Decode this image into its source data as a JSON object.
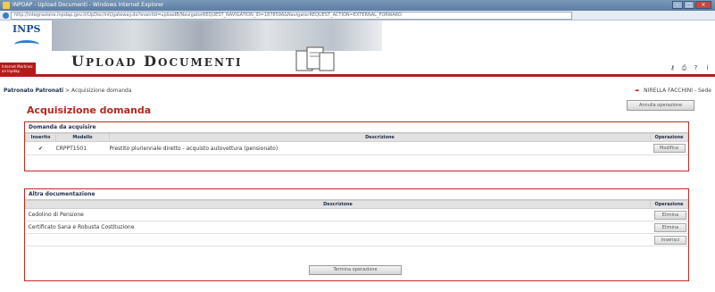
{
  "window": {
    "title": "INPOAP - Upload Documenti - Windows Internet Explorer",
    "url": "http://integrazione.inpdap.gov.it/UpDoc/init/gateway.do?eventId=uploadB/NavigatorREQUEST_NAVIGATION_ID=1878596&NavigatorREQUEST_ACTION=EXTERNAL_FORWARD"
  },
  "banner": {
    "logo_text": "INPS",
    "app_title_first": "U",
    "app_title_first_rest": "PLOAD",
    "app_title_second": "D",
    "app_title_second_rest": "OCUMENTI",
    "red_block_text": "Internet Martinez on Inpdap",
    "icons": [
      "key-icon",
      "printer-icon",
      "help-icon",
      "info-icon"
    ]
  },
  "breadcrumb": {
    "root": "Patronato Patronati",
    "separator": ">",
    "current": "Acquisizione domanda"
  },
  "user": {
    "name": "NIRELLA FACCHINI",
    "suffix": "- Sede"
  },
  "actions": {
    "annulla": "Annulla operazione",
    "termina": "Termina operazione"
  },
  "page_title": "Acquisizione domanda",
  "domanda": {
    "heading": "Domanda da acquisire",
    "columns": {
      "inserito": "Inserito",
      "modello": "Modello",
      "descrizione": "Descrizione",
      "operazione": "Operazione"
    },
    "rows": [
      {
        "modello": "CRPPT1501",
        "descrizione": "Prestito pluriennale diretto - acquisto autovettura (pensionato)",
        "operazione": "Modifica"
      }
    ]
  },
  "altra": {
    "heading": "Altra documentazione",
    "columns": {
      "descrizione": "Descrizione",
      "operazione": "Operazione"
    },
    "rows": [
      {
        "descrizione": "Cedolino di Pensione",
        "operazione": "Elimina"
      },
      {
        "descrizione": "Certificato Sana e Robusta Costituzione",
        "operazione": "Elimina"
      }
    ],
    "insert_label": "Inserisci"
  },
  "colors": {
    "accent_red": "#b3281e",
    "check_green": "#4aa329"
  }
}
